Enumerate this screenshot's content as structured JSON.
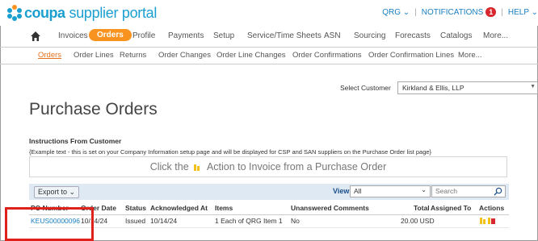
{
  "brand": {
    "name": "coupa",
    "sub": "supplier portal"
  },
  "topbar": {
    "user": "QRG",
    "notifications_label": "NOTIFICATIONS",
    "notifications_count": "1",
    "help_label": "HELP"
  },
  "primary_nav": [
    "Invoices",
    "Orders",
    "Profile",
    "Payments",
    "Setup",
    "Service/Time Sheets",
    "ASN",
    "Sourcing",
    "Forecasts",
    "Catalogs",
    "More..."
  ],
  "secondary_nav": [
    "Orders",
    "Order Lines",
    "Returns",
    "Order Changes",
    "Order Line Changes",
    "Order Confirmations",
    "Order Confirmation Lines",
    "More..."
  ],
  "customer": {
    "label": "Select Customer",
    "value": "Kirkland & Ellis, LLP"
  },
  "page_title": "Purchase Orders",
  "instructions": {
    "heading": "Instructions From Customer",
    "text": "{Example text - this is set on your Company Information setup page and will be displayed for CSP and SAN suppliers on the Purchase Order list page}",
    "callout_before": "Click the",
    "callout_after": "Action to Invoice from a Purchase Order"
  },
  "toolbar": {
    "export_label": "Export to",
    "view_label": "View",
    "view_value": "All",
    "search_placeholder": "Search"
  },
  "table": {
    "headers": [
      "PO Number",
      "Order Date",
      "Status",
      "Acknowledged At",
      "Items",
      "Unanswered Comments",
      "Total",
      "Assigned To",
      "Actions"
    ],
    "rows": [
      {
        "po": "KEUS00000096",
        "date": "10/14/24",
        "status": "Issued",
        "ack": "10/14/24",
        "items": "1 Each of QRG Item 1",
        "comments": "No",
        "total": "20.00 USD",
        "assigned": ""
      }
    ]
  },
  "colors": {
    "brand": "#1a9fd0",
    "accent": "#f7931e",
    "highlight": "#e0201b"
  }
}
